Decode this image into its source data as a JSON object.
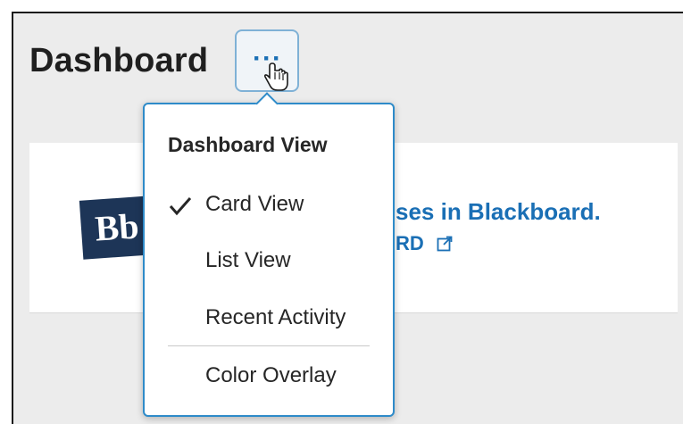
{
  "header": {
    "title": "Dashboard",
    "menu_button_glyph": "···"
  },
  "card": {
    "logo_text": "Bb",
    "text_line1": "ses in Blackboard.",
    "text_line2": "RD"
  },
  "dropdown": {
    "header": "Dashboard View",
    "items": [
      {
        "label": "Card View",
        "checked": true
      },
      {
        "label": "List View",
        "checked": false
      },
      {
        "label": "Recent Activity",
        "checked": false
      },
      {
        "label": "Color Overlay",
        "checked": false
      }
    ]
  },
  "colors": {
    "accent": "#1a6fb5",
    "menu_border": "#2e8bc9",
    "logo_bg": "#1d3557"
  },
  "icons": [
    "more-options-icon",
    "hand-cursor-icon",
    "checkmark-icon",
    "external-link-icon"
  ]
}
